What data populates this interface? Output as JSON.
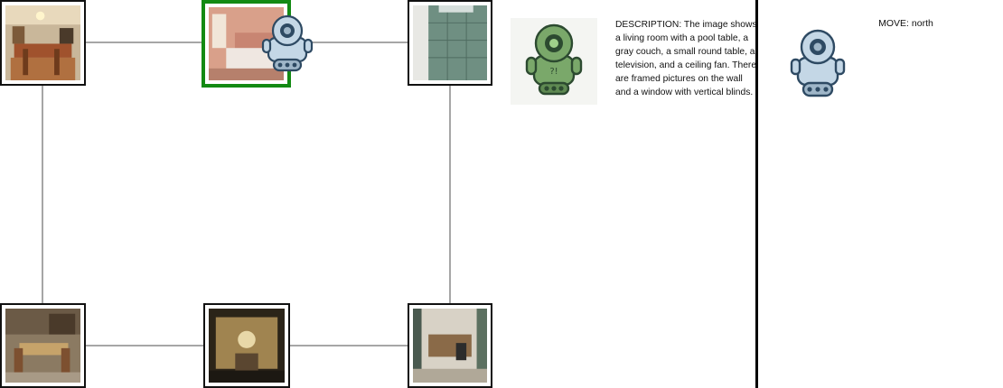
{
  "description_label": "DESCRIPTION: The image shows a living room with a pool table, a gray couch, a small round table, a television, and a ceiling fan. There are framed pictures on the wall and a window with vertical blinds.",
  "move_label": "MOVE: north",
  "colors": {
    "current_room_border": "#138a13",
    "tile_border": "#111111",
    "connector": "#888888",
    "robot_body": "#c4d7e6",
    "robot_outline": "#2e4a63",
    "green_robot": "#7aa86a"
  },
  "rooms": [
    {
      "name": "dining-room",
      "current": false
    },
    {
      "name": "bedroom",
      "current": true
    },
    {
      "name": "bathroom",
      "current": false
    },
    {
      "name": "formal-dining-room",
      "current": false
    },
    {
      "name": "ornate-hall",
      "current": false
    },
    {
      "name": "home-office",
      "current": false
    }
  ],
  "icons": {
    "agent": "robot-icon",
    "narrator": "green-robot-icon"
  }
}
